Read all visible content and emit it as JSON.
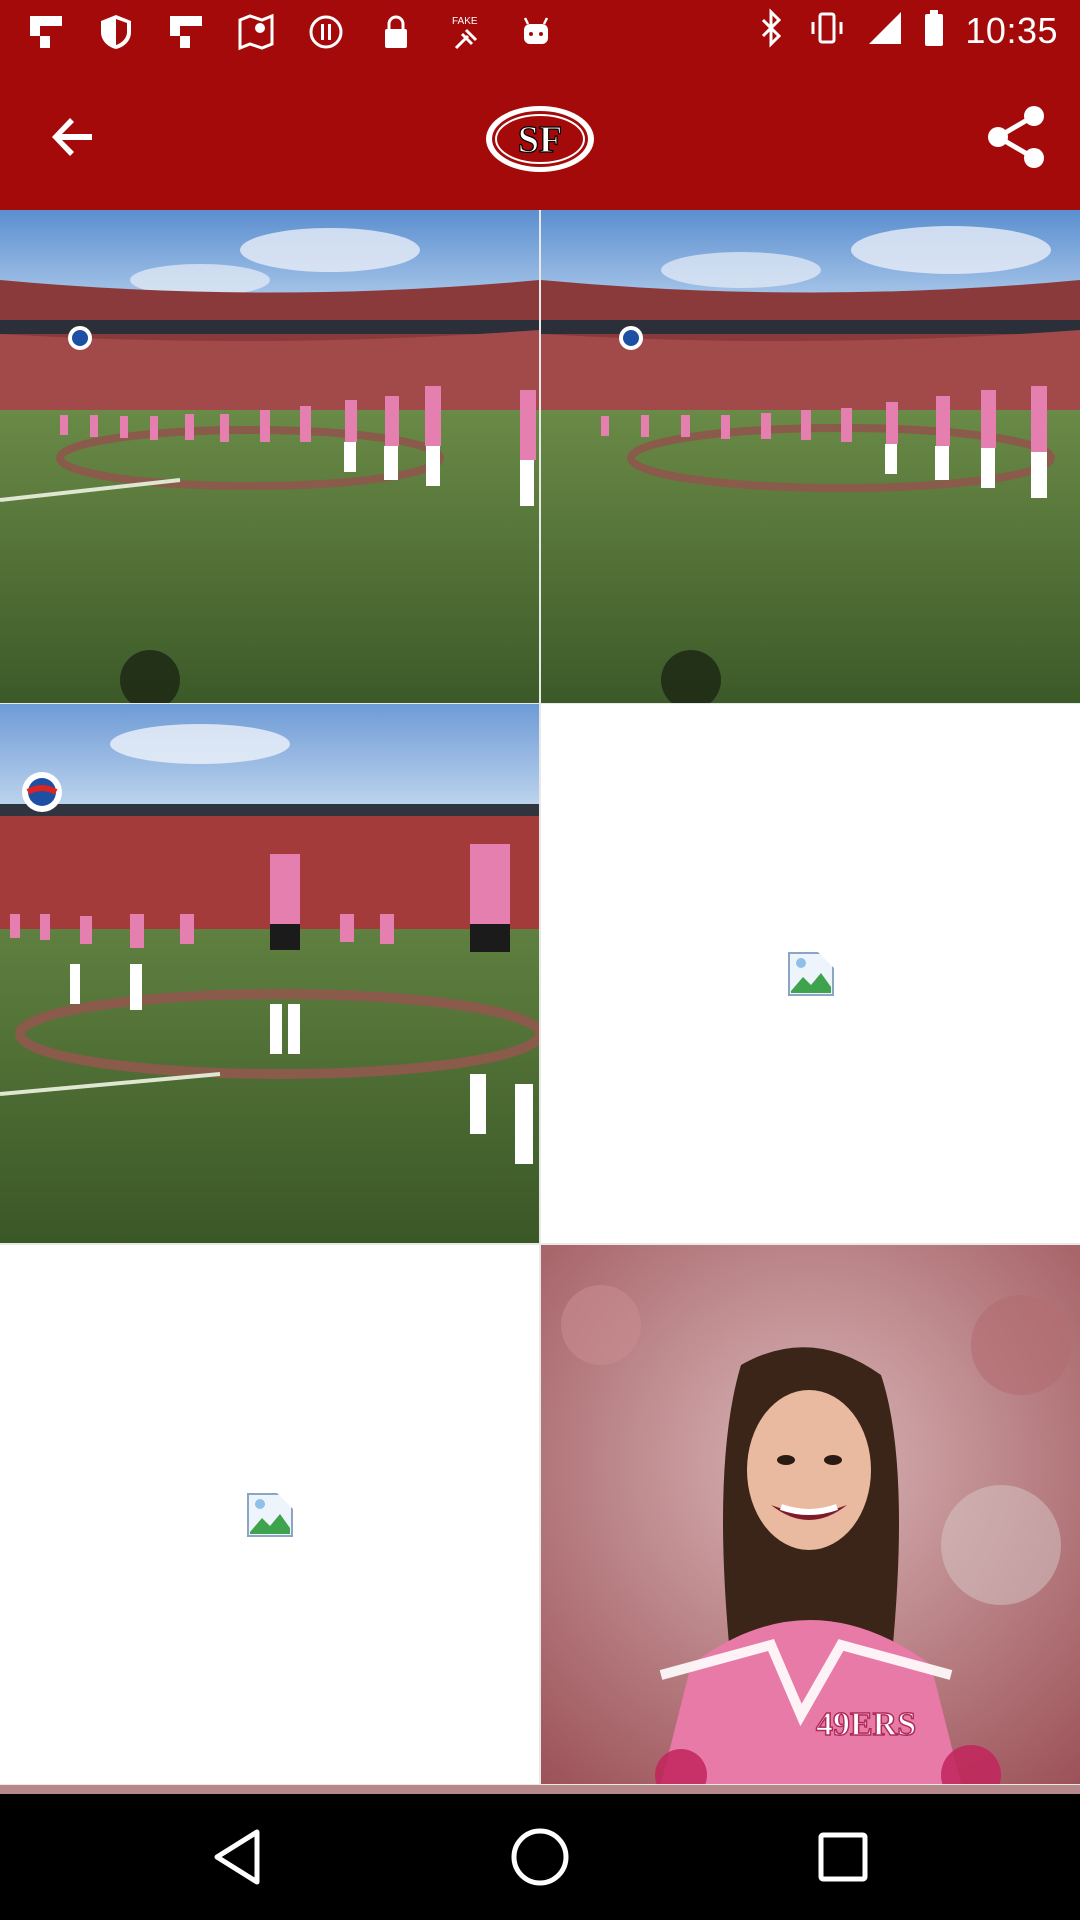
{
  "status_bar": {
    "time": "10:35",
    "left_icons": [
      "flipboard-icon",
      "shield-icon",
      "flipboard-icon",
      "maps-icon",
      "pause-circle-icon",
      "lock-icon",
      "fake-gps-icon",
      "android-icon"
    ],
    "right_icons": [
      "bluetooth-icon",
      "vibrate-icon",
      "signal-icon",
      "battery-icon"
    ]
  },
  "app_bar": {
    "logo_text": "SF",
    "background_color": "#a50a0a"
  },
  "gallery": {
    "images": [
      {
        "type": "photo",
        "description_icon": "stadium-photo"
      },
      {
        "type": "photo",
        "description_icon": "stadium-photo"
      },
      {
        "type": "photo",
        "description_icon": "stadium-photo"
      },
      {
        "type": "broken",
        "description_icon": "broken-image-icon"
      },
      {
        "type": "broken",
        "description_icon": "broken-image-icon"
      },
      {
        "type": "photo",
        "description_icon": "portrait-photo",
        "jersey_text": "49ERS"
      }
    ]
  },
  "nav_bar": {
    "buttons": [
      "back",
      "home",
      "recents"
    ]
  }
}
